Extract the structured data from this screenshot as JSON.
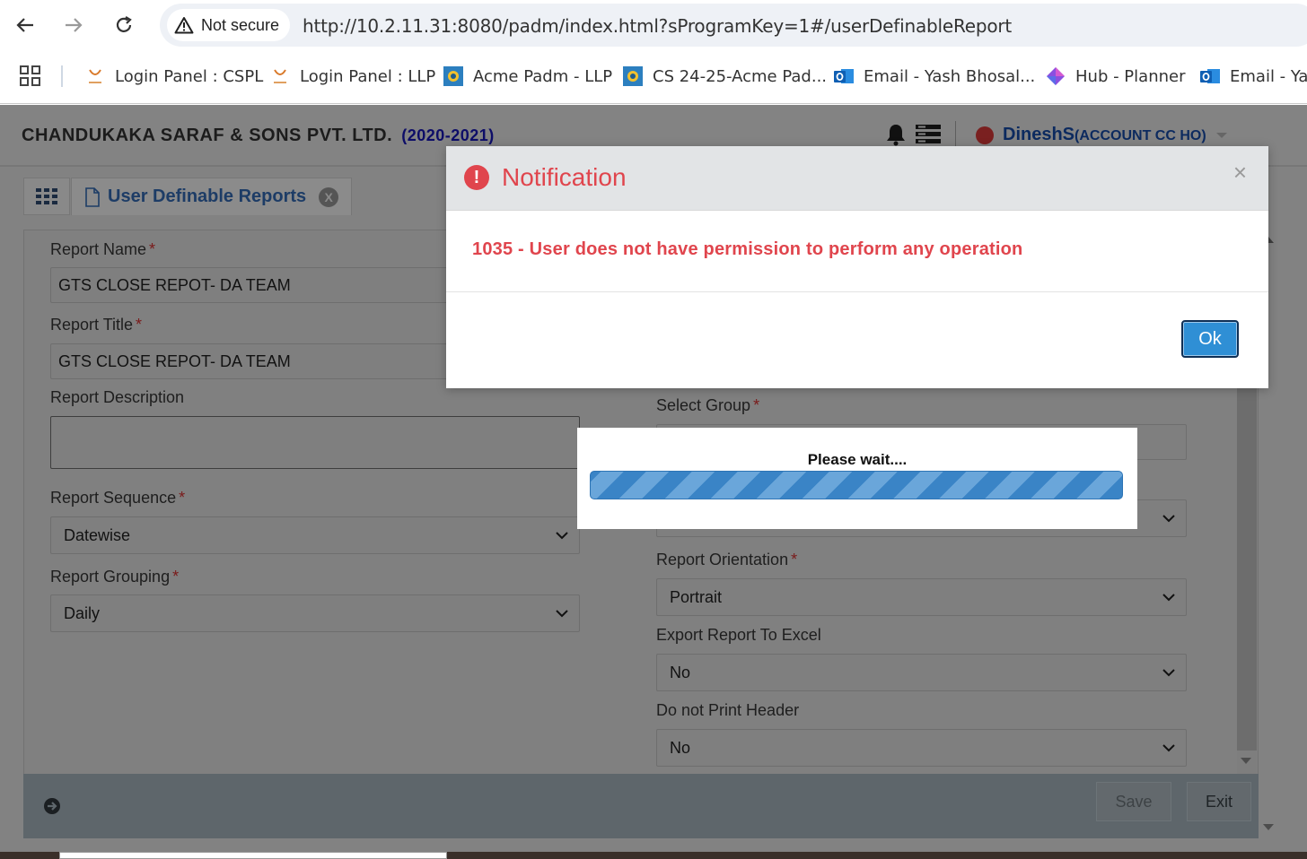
{
  "browser": {
    "security_label": "Not secure",
    "url": "http://10.2.11.31:8080/padm/index.html?sProgramKey=1#/userDefinableReport",
    "bookmarks": [
      {
        "label": "Login Panel : CSPL",
        "icon": "cspl-logo-icon"
      },
      {
        "label": "Login Panel : LLP",
        "icon": "cspl-logo-icon"
      },
      {
        "label": "Acme Padm - LLP",
        "icon": "padm-icon"
      },
      {
        "label": "CS 24-25-Acme Pad...",
        "icon": "padm-icon"
      },
      {
        "label": "Email - Yash Bhosal...",
        "icon": "outlook-icon"
      },
      {
        "label": "Hub - Planner",
        "icon": "planner-icon"
      },
      {
        "label": "Email - Yas",
        "icon": "outlook-icon"
      }
    ]
  },
  "header": {
    "company": "CHANDUKAKA SARAF & SONS PVT. LTD.",
    "financial_year": "(2020-2021)",
    "user_name": "DineshS",
    "user_role": "(ACCOUNT CC HO)"
  },
  "tabs": {
    "active_label": "User Definable Reports",
    "close_glyph": "X"
  },
  "form": {
    "report_name": {
      "label": "Report Name",
      "value": "GTS CLOSE REPOT- DA TEAM"
    },
    "report_title": {
      "label": "Report Title",
      "value": "GTS CLOSE REPOT- DA TEAM"
    },
    "report_description": {
      "label": "Report Description",
      "value": ""
    },
    "report_sequence": {
      "label": "Report Sequence",
      "value": "Datewise"
    },
    "report_grouping": {
      "label": "Report Grouping",
      "value": "Daily"
    },
    "select_group": {
      "label": "Select Group",
      "value": ""
    },
    "report_orientation": {
      "label": "Report Orientation",
      "value": "Portrait"
    },
    "export_excel": {
      "label": "Export Report To Excel",
      "value": "No"
    },
    "no_print_header": {
      "label": "Do not Print Header",
      "value": "No"
    },
    "required_mark": "*"
  },
  "footer": {
    "save_label": "Save",
    "exit_label": "Exit"
  },
  "notification": {
    "title": "Notification",
    "close_glyph": "×",
    "message": "1035 - User does not have permission to perform any operation",
    "ok_label": "Ok"
  },
  "loading": {
    "text": "Please wait...."
  },
  "colors": {
    "error_red": "#e0454d",
    "ok_blue": "#2f8fd5",
    "progress_blue": "#3580c3"
  }
}
